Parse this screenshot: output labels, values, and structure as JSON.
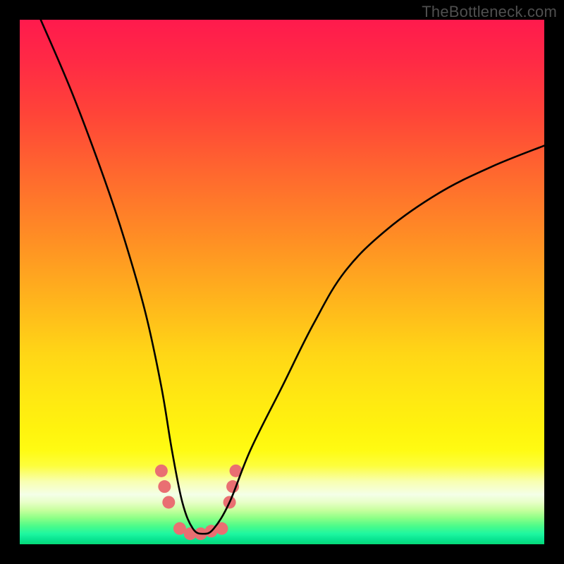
{
  "watermark": "TheBottleneck.com",
  "chart_data": {
    "type": "line",
    "title": "",
    "xlabel": "",
    "ylabel": "",
    "xlim": [
      0,
      100
    ],
    "ylim": [
      0,
      100
    ],
    "series": [
      {
        "name": "bottleneck-curve",
        "x": [
          4,
          10,
          16,
          20,
          24,
          27,
          29,
          31,
          33,
          35,
          37,
          40,
          44,
          50,
          56,
          62,
          70,
          80,
          90,
          100
        ],
        "y_pct": [
          100,
          86,
          70,
          58,
          44,
          30,
          18,
          8,
          3,
          2,
          3,
          8,
          18,
          30,
          42,
          52,
          60,
          67,
          72,
          76
        ]
      }
    ],
    "markers": {
      "name": "trough-markers",
      "color": "#e96f72",
      "radius_px": 9,
      "points": [
        {
          "x": 27.0,
          "y_pct": 14.0
        },
        {
          "x": 27.6,
          "y_pct": 11.0
        },
        {
          "x": 28.4,
          "y_pct": 8.0
        },
        {
          "x": 30.5,
          "y_pct": 3.0
        },
        {
          "x": 32.5,
          "y_pct": 2.0
        },
        {
          "x": 34.5,
          "y_pct": 2.0
        },
        {
          "x": 36.5,
          "y_pct": 2.5
        },
        {
          "x": 38.5,
          "y_pct": 3.0
        },
        {
          "x": 40.0,
          "y_pct": 8.0
        },
        {
          "x": 40.6,
          "y_pct": 11.0
        },
        {
          "x": 41.2,
          "y_pct": 14.0
        }
      ]
    },
    "gradient_stops": [
      {
        "pos": 0.0,
        "color": "#ff1a4d"
      },
      {
        "pos": 0.3,
        "color": "#ff6a2e"
      },
      {
        "pos": 0.64,
        "color": "#ffd716"
      },
      {
        "pos": 0.82,
        "color": "#fffb12"
      },
      {
        "pos": 0.905,
        "color": "#f4ffe8"
      },
      {
        "pos": 0.95,
        "color": "#8dff86"
      },
      {
        "pos": 1.0,
        "color": "#06d977"
      }
    ]
  }
}
